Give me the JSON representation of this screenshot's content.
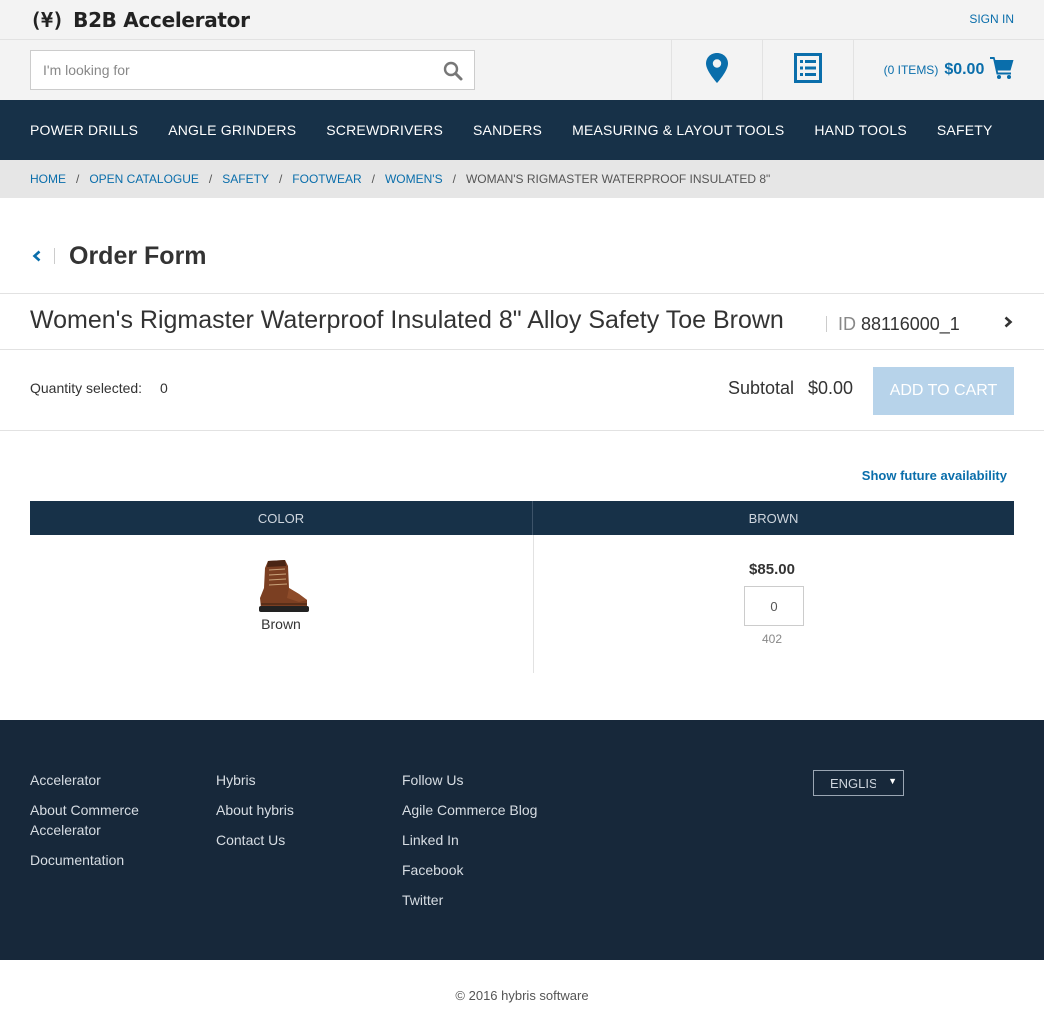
{
  "header": {
    "logo_mark": "(¥)",
    "brand": "B2B Accelerator",
    "sign_in": "SIGN IN",
    "search_placeholder": "I'm looking for",
    "cart_items": "(0 ITEMS)",
    "cart_total": "$0.00"
  },
  "nav": {
    "categories": [
      "POWER DRILLS",
      "ANGLE GRINDERS",
      "SCREWDRIVERS",
      "SANDERS",
      "MEASURING & LAYOUT TOOLS",
      "HAND TOOLS",
      "SAFETY"
    ]
  },
  "breadcrumb": {
    "items": [
      "HOME",
      "OPEN CATALOGUE",
      "SAFETY",
      "FOOTWEAR",
      "WOMEN'S"
    ],
    "current": "WOMAN'S RIGMASTER WATERPROOF INSULATED 8\""
  },
  "order_form": {
    "title": "Order Form"
  },
  "product": {
    "name": "Women's Rigmaster Waterproof Insulated 8\" Alloy Safety Toe Brown",
    "id_label": "ID",
    "id": "88116000_1"
  },
  "summary": {
    "quantity_label": "Quantity selected:",
    "quantity_value": "0",
    "subtotal_label": "Subtotal",
    "subtotal_value": "$0.00",
    "add_to_cart": "ADD TO CART"
  },
  "availability": {
    "future_link": "Show future availability"
  },
  "grid": {
    "col_header_left": "COLOR",
    "col_header_right": "BROWN",
    "variant_name": "Brown",
    "price": "$85.00",
    "qty_value": "0",
    "stock": "402"
  },
  "footer": {
    "col1": [
      "Accelerator",
      "About Commerce Accelerator",
      "Documentation"
    ],
    "col2": [
      "Hybris",
      "About hybris",
      "Contact Us"
    ],
    "col3": [
      "Follow Us",
      "Agile Commerce Blog",
      "Linked In",
      "Facebook",
      "Twitter"
    ],
    "language": "ENGLISH",
    "copyright": "© 2016 hybris software"
  },
  "colors": {
    "accent": "#0a6eab",
    "nav_bg": "#173148",
    "footer_bg": "#17283a",
    "add_to_cart_disabled": "#b7d3ea"
  },
  "icons": {
    "search": "search-icon",
    "location": "map-marker-icon",
    "quick_order": "list-icon",
    "cart": "shopping-cart-icon",
    "back": "chevron-left-icon",
    "next": "chevron-right-icon",
    "caret": "caret-down-icon"
  }
}
